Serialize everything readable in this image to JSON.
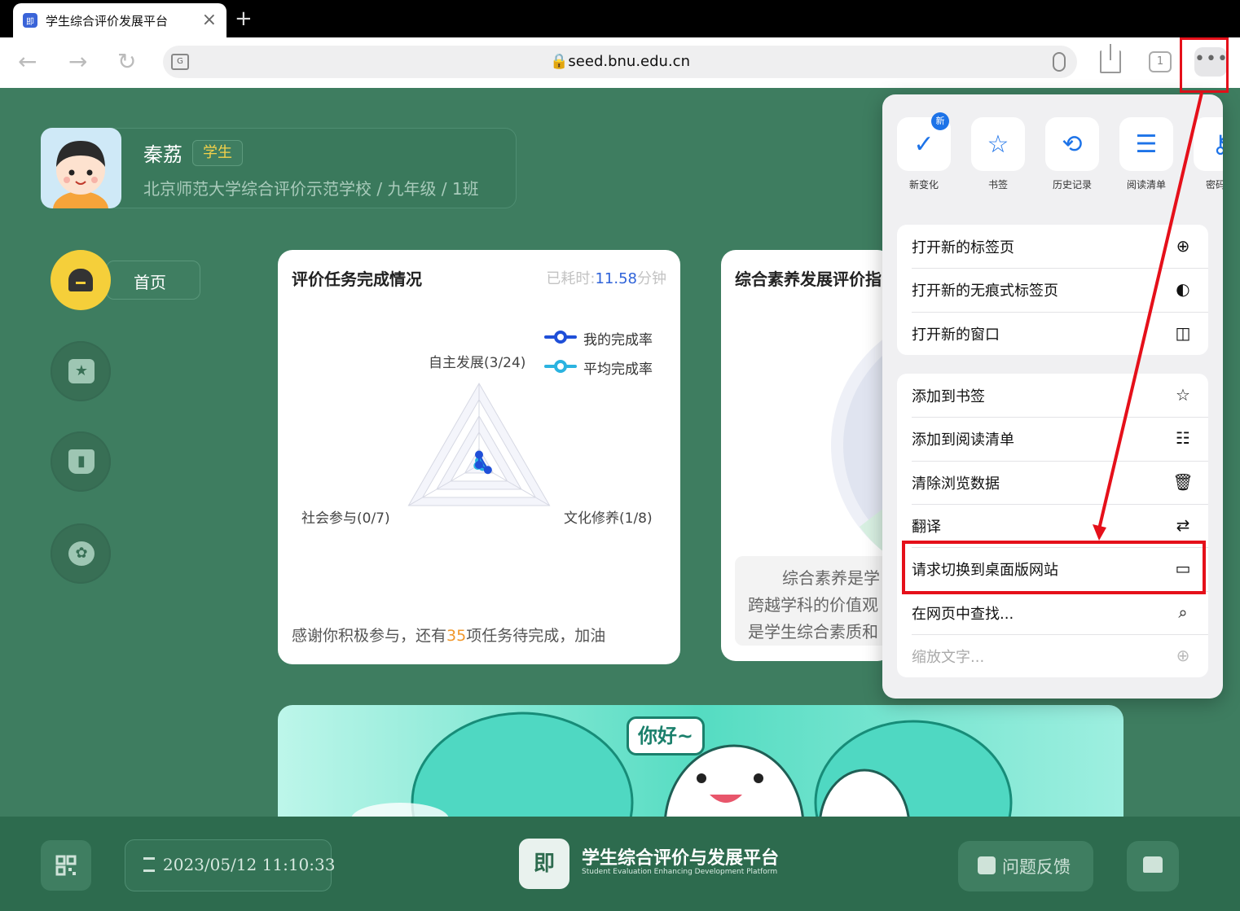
{
  "browser": {
    "tab_title": "学生综合评价发展平台",
    "tab_favicon": "即",
    "url": "🔒seed.bnu.edu.cn",
    "tab_count": "1",
    "more_label": "•••",
    "new_tab_label": "+"
  },
  "profile": {
    "name": "秦荔",
    "role": "学生",
    "school": "北京师范大学综合评价示范学校 / 九年级 / 1班"
  },
  "nav": {
    "home_label": "首页",
    "icons": [
      "home-icon",
      "star-badge-icon",
      "book-icon",
      "community-icon"
    ]
  },
  "task_card": {
    "title": "评价任务完成情况",
    "elapsed_prefix": "已耗时:",
    "elapsed_value": "11.58",
    "elapsed_unit": "分钟",
    "legend_mine": "我的完成率",
    "legend_avg": "平均完成率",
    "label_top": "自主发展(3/24)",
    "label_left": "社会参与(0/7)",
    "label_right": "文化修养(1/8)",
    "thanks_prefix": "感谢你积极参与，还有",
    "thanks_count": "35",
    "thanks_suffix": "项任务待完成，加油",
    "colors": {
      "mine": "#1f4fd8",
      "avg": "#2bb3e0"
    }
  },
  "chart_data": {
    "type": "radar",
    "axes": [
      "自主发展(3/24)",
      "文化修养(1/8)",
      "社会参与(0/7)"
    ],
    "series": [
      {
        "name": "我的完成率",
        "values": [
          0.125,
          0.125,
          0.0
        ]
      },
      {
        "name": "平均完成率",
        "values": [
          0.05,
          0.05,
          0.02
        ]
      }
    ],
    "legend_position": "top-right"
  },
  "eval_card": {
    "title": "综合素养发展评价指",
    "desc_line1": "综合素养是学",
    "desc_line2": "跨越学科的价值观",
    "desc_line3": "是学生综合素质和"
  },
  "banner": {
    "greeting": "你好~"
  },
  "bottom": {
    "datetime": "2023/05/12 11:10:33",
    "logo_mark": "即",
    "platform_name": "学生综合评价与发展平台",
    "platform_sub": "Student Evaluation Enhancing Development Platform",
    "feedback": "问题反馈"
  },
  "menu": {
    "quick_actions": [
      {
        "label": "新变化",
        "icon": "new-badge-icon",
        "glyph": "✓",
        "badge": "新"
      },
      {
        "label": "书签",
        "icon": "star-icon",
        "glyph": "☆"
      },
      {
        "label": "历史记录",
        "icon": "history-icon",
        "glyph": "⟲"
      },
      {
        "label": "阅读清单",
        "icon": "reading-list-icon",
        "glyph": "☰"
      },
      {
        "label": "密码管",
        "icon": "key-icon",
        "glyph": "⚷"
      }
    ],
    "group1": [
      {
        "label": "打开新的标签页",
        "icon": "plus-circle-icon",
        "glyph": "⊕"
      },
      {
        "label": "打开新的无痕式标签页",
        "icon": "incognito-icon",
        "glyph": "◐"
      },
      {
        "label": "打开新的窗口",
        "icon": "window-split-icon",
        "glyph": "◫"
      }
    ],
    "group2": [
      {
        "label": "添加到书签",
        "icon": "star-outline-icon",
        "glyph": "☆"
      },
      {
        "label": "添加到阅读清单",
        "icon": "reading-list-add-icon",
        "glyph": "☷"
      },
      {
        "label": "清除浏览数据",
        "icon": "trash-icon",
        "glyph": "🗑"
      },
      {
        "label": "翻译",
        "icon": "translate-icon",
        "glyph": "⇄"
      },
      {
        "label": "请求切换到桌面版网站",
        "icon": "desktop-icon",
        "glyph": "▭"
      },
      {
        "label": "在网页中查找...",
        "icon": "find-in-page-icon",
        "glyph": "⌕"
      },
      {
        "label": "缩放文字...",
        "icon": "zoom-icon",
        "glyph": "⊕",
        "disabled": true
      }
    ],
    "highlight_color": "#e5101a"
  }
}
